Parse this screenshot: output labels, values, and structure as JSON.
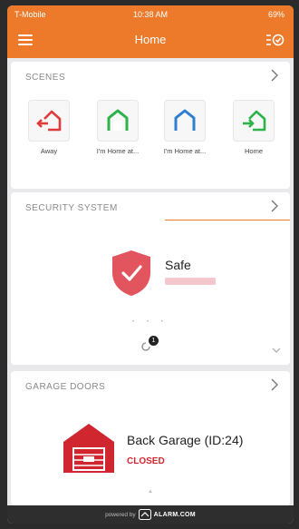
{
  "status_bar": {
    "carrier": "T-Mobile",
    "time": "10:38 AM",
    "battery": "69%"
  },
  "nav": {
    "title": "Home"
  },
  "scenes": {
    "header": "SCENES",
    "items": [
      {
        "name": "Away",
        "icon": "away-exit-icon",
        "color": "#e03a3a"
      },
      {
        "name": "I'm Home at...",
        "icon": "garage-home-icon",
        "color": "#2db34a"
      },
      {
        "name": "I'm Home at...",
        "icon": "garage-home-icon",
        "color": "#2f7fd1"
      },
      {
        "name": "Home",
        "icon": "home-enter-icon",
        "color": "#2db34a"
      }
    ]
  },
  "security": {
    "header": "SECURITY SYSTEM",
    "state": "Safe",
    "notification_count": "1"
  },
  "garage": {
    "header": "GARAGE DOORS",
    "name": "Back Garage (ID:24)",
    "status": "CLOSED"
  },
  "footer": {
    "powered_by": "powered by",
    "brand": "ALARM.COM"
  },
  "colors": {
    "accent": "#ec7a2a",
    "alarm_red": "#d0262f",
    "shield_red": "#e2545e"
  }
}
